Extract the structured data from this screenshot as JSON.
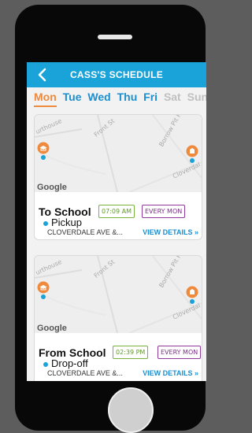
{
  "colors": {
    "accent_blue": "#1aa3d8",
    "active_day": "#ef8a3c",
    "time_badge": "#79b03e",
    "frequency_badge": "#8f3a9a",
    "inactive_day": "#c0c0c0"
  },
  "header": {
    "title": "CASS'S SCHEDULE",
    "back_icon": "chevron-left-icon"
  },
  "days": [
    {
      "label": "Mon",
      "state": "active"
    },
    {
      "label": "Tue",
      "state": "enabled"
    },
    {
      "label": "Wed",
      "state": "enabled"
    },
    {
      "label": "Thu",
      "state": "enabled"
    },
    {
      "label": "Fri",
      "state": "enabled"
    },
    {
      "label": "Sat",
      "state": "inactive"
    },
    {
      "label": "Sun",
      "state": "inactive"
    }
  ],
  "map_labels": {
    "road_1": "urthouse",
    "road_2": "Front St",
    "road_3": "Borrow Pit R",
    "road_4": "Cloverdal",
    "logo": "Google"
  },
  "trips": [
    {
      "title": "To School",
      "time": "07:09 AM",
      "frequency": "EVERY MON",
      "stop_type": "Pickup",
      "address": "CLOVERDALE AVE &...",
      "action": "VIEW DETAILS »"
    },
    {
      "title": "From School",
      "time": "02:39 PM",
      "frequency": "EVERY MON",
      "stop_type": "Drop-off",
      "address": "CLOVERDALE AVE &...",
      "action": "VIEW DETAILS »"
    }
  ]
}
